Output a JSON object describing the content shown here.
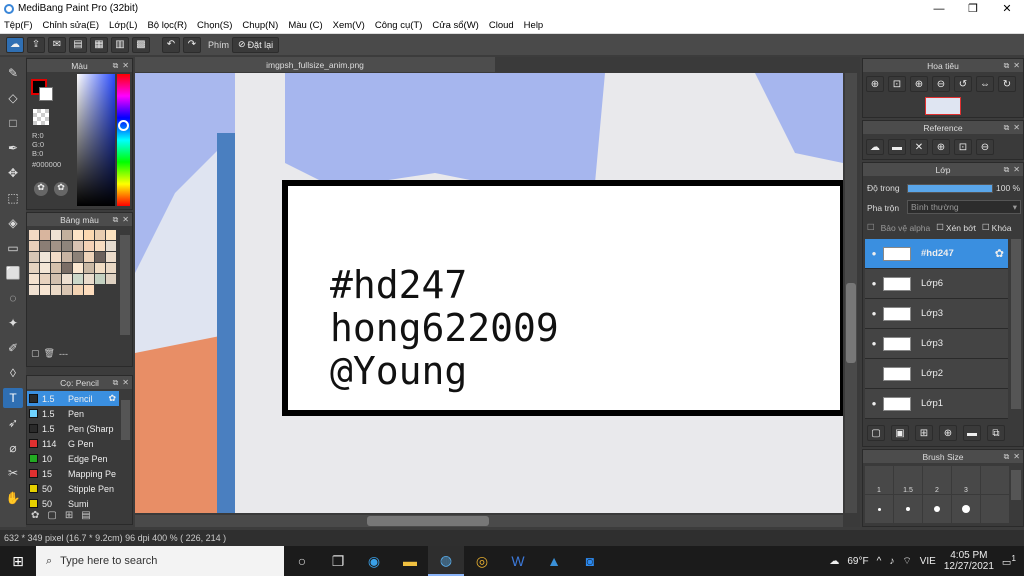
{
  "window": {
    "title": "MediBang Paint Pro (32bit)",
    "min": "—",
    "max": "❐",
    "close": "✕"
  },
  "menu": [
    "Tệp(F)",
    "Chỉnh sửa(E)",
    "Lớp(L)",
    "Bộ lọc(R)",
    "Chọn(S)",
    "Chụp(N)",
    "Màu (C)",
    "Xem(V)",
    "Công cụ(T)",
    "Cửa sổ(W)",
    "Cloud",
    "Help"
  ],
  "toolbar": {
    "key_label": "Phím",
    "reset_label": "Đặt lại"
  },
  "color_panel": {
    "title": "Màu",
    "r": "R:0",
    "g": "G:0",
    "b": "B:0",
    "hex": "#000000"
  },
  "palette_panel": {
    "title": "Bảng màu",
    "more": "---"
  },
  "brush_panel": {
    "title": "Cọ: Pencil",
    "brushes": [
      {
        "size": "1.5",
        "name": "Pencil",
        "color": "#2a2a2a",
        "selected": true
      },
      {
        "size": "1.5",
        "name": "Pen",
        "color": "#6fd3ff",
        "selected": false
      },
      {
        "size": "1.5",
        "name": "Pen (Sharp",
        "color": "#2a2a2a",
        "selected": false
      },
      {
        "size": "114",
        "name": "G Pen",
        "color": "#e03030",
        "selected": false
      },
      {
        "size": "10",
        "name": "Edge Pen",
        "color": "#22aa22",
        "selected": false
      },
      {
        "size": "15",
        "name": "Mapping Pe",
        "color": "#e03030",
        "selected": false
      },
      {
        "size": "50",
        "name": "Stipple Pen",
        "color": "#e6d000",
        "selected": false
      },
      {
        "size": "50",
        "name": "Sumi",
        "color": "#e6d000",
        "selected": false
      }
    ]
  },
  "document": {
    "tab": "imgpsh_fullsize_anim.png",
    "line1": "#hd247",
    "line2": "hong622009",
    "line3": "@Young"
  },
  "navigator": {
    "title": "Hoa tiêu"
  },
  "reference": {
    "title": "Reference"
  },
  "layers": {
    "title": "Lớp",
    "opacity_label": "Độ trong",
    "opacity_value": "100 %",
    "opacity_fraction": 1.0,
    "blend_label": "Pha trộn",
    "blend_value": "Bình thường",
    "protect_alpha": "Bảo vệ alpha",
    "clipping": "Xén bớt",
    "lock": "Khóa",
    "items": [
      {
        "name": "#hd247",
        "selected": true,
        "visible": true
      },
      {
        "name": "Lớp6",
        "selected": false,
        "visible": true
      },
      {
        "name": "Lớp3",
        "selected": false,
        "visible": true
      },
      {
        "name": "Lớp3",
        "selected": false,
        "visible": true
      },
      {
        "name": "Lớp2",
        "selected": false,
        "visible": false
      },
      {
        "name": "Lớp1",
        "selected": false,
        "visible": true
      }
    ]
  },
  "brush_size": {
    "title": "Brush Size",
    "labels": [
      "1",
      "1.5",
      "2",
      "3"
    ]
  },
  "status": {
    "text": "632 * 349 pixel  (16.7 * 9.2cm)  96 dpi  400 %  ( 226, 214 )"
  },
  "taskbar": {
    "search_placeholder": "Type here to search",
    "weather": "69°F",
    "lang": "VIE",
    "time": "4:05 PM",
    "date": "12/27/2021",
    "notif": "1"
  }
}
